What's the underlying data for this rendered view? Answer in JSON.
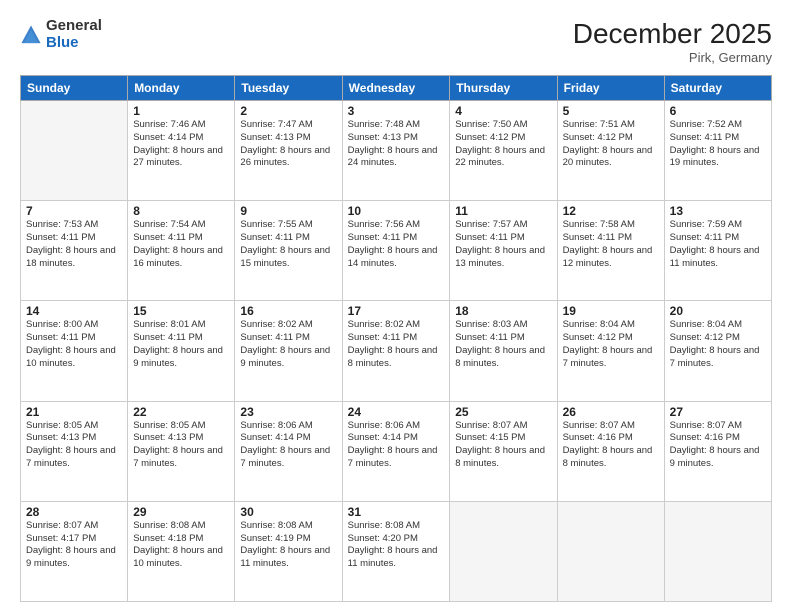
{
  "header": {
    "logo_general": "General",
    "logo_blue": "Blue",
    "month_title": "December 2025",
    "location": "Pirk, Germany"
  },
  "days_of_week": [
    "Sunday",
    "Monday",
    "Tuesday",
    "Wednesday",
    "Thursday",
    "Friday",
    "Saturday"
  ],
  "weeks": [
    [
      {
        "num": "",
        "sunrise": "",
        "sunset": "",
        "daylight": ""
      },
      {
        "num": "1",
        "sunrise": "Sunrise: 7:46 AM",
        "sunset": "Sunset: 4:14 PM",
        "daylight": "Daylight: 8 hours and 27 minutes."
      },
      {
        "num": "2",
        "sunrise": "Sunrise: 7:47 AM",
        "sunset": "Sunset: 4:13 PM",
        "daylight": "Daylight: 8 hours and 26 minutes."
      },
      {
        "num": "3",
        "sunrise": "Sunrise: 7:48 AM",
        "sunset": "Sunset: 4:13 PM",
        "daylight": "Daylight: 8 hours and 24 minutes."
      },
      {
        "num": "4",
        "sunrise": "Sunrise: 7:50 AM",
        "sunset": "Sunset: 4:12 PM",
        "daylight": "Daylight: 8 hours and 22 minutes."
      },
      {
        "num": "5",
        "sunrise": "Sunrise: 7:51 AM",
        "sunset": "Sunset: 4:12 PM",
        "daylight": "Daylight: 8 hours and 20 minutes."
      },
      {
        "num": "6",
        "sunrise": "Sunrise: 7:52 AM",
        "sunset": "Sunset: 4:11 PM",
        "daylight": "Daylight: 8 hours and 19 minutes."
      }
    ],
    [
      {
        "num": "7",
        "sunrise": "Sunrise: 7:53 AM",
        "sunset": "Sunset: 4:11 PM",
        "daylight": "Daylight: 8 hours and 18 minutes."
      },
      {
        "num": "8",
        "sunrise": "Sunrise: 7:54 AM",
        "sunset": "Sunset: 4:11 PM",
        "daylight": "Daylight: 8 hours and 16 minutes."
      },
      {
        "num": "9",
        "sunrise": "Sunrise: 7:55 AM",
        "sunset": "Sunset: 4:11 PM",
        "daylight": "Daylight: 8 hours and 15 minutes."
      },
      {
        "num": "10",
        "sunrise": "Sunrise: 7:56 AM",
        "sunset": "Sunset: 4:11 PM",
        "daylight": "Daylight: 8 hours and 14 minutes."
      },
      {
        "num": "11",
        "sunrise": "Sunrise: 7:57 AM",
        "sunset": "Sunset: 4:11 PM",
        "daylight": "Daylight: 8 hours and 13 minutes."
      },
      {
        "num": "12",
        "sunrise": "Sunrise: 7:58 AM",
        "sunset": "Sunset: 4:11 PM",
        "daylight": "Daylight: 8 hours and 12 minutes."
      },
      {
        "num": "13",
        "sunrise": "Sunrise: 7:59 AM",
        "sunset": "Sunset: 4:11 PM",
        "daylight": "Daylight: 8 hours and 11 minutes."
      }
    ],
    [
      {
        "num": "14",
        "sunrise": "Sunrise: 8:00 AM",
        "sunset": "Sunset: 4:11 PM",
        "daylight": "Daylight: 8 hours and 10 minutes."
      },
      {
        "num": "15",
        "sunrise": "Sunrise: 8:01 AM",
        "sunset": "Sunset: 4:11 PM",
        "daylight": "Daylight: 8 hours and 9 minutes."
      },
      {
        "num": "16",
        "sunrise": "Sunrise: 8:02 AM",
        "sunset": "Sunset: 4:11 PM",
        "daylight": "Daylight: 8 hours and 9 minutes."
      },
      {
        "num": "17",
        "sunrise": "Sunrise: 8:02 AM",
        "sunset": "Sunset: 4:11 PM",
        "daylight": "Daylight: 8 hours and 8 minutes."
      },
      {
        "num": "18",
        "sunrise": "Sunrise: 8:03 AM",
        "sunset": "Sunset: 4:11 PM",
        "daylight": "Daylight: 8 hours and 8 minutes."
      },
      {
        "num": "19",
        "sunrise": "Sunrise: 8:04 AM",
        "sunset": "Sunset: 4:12 PM",
        "daylight": "Daylight: 8 hours and 7 minutes."
      },
      {
        "num": "20",
        "sunrise": "Sunrise: 8:04 AM",
        "sunset": "Sunset: 4:12 PM",
        "daylight": "Daylight: 8 hours and 7 minutes."
      }
    ],
    [
      {
        "num": "21",
        "sunrise": "Sunrise: 8:05 AM",
        "sunset": "Sunset: 4:13 PM",
        "daylight": "Daylight: 8 hours and 7 minutes."
      },
      {
        "num": "22",
        "sunrise": "Sunrise: 8:05 AM",
        "sunset": "Sunset: 4:13 PM",
        "daylight": "Daylight: 8 hours and 7 minutes."
      },
      {
        "num": "23",
        "sunrise": "Sunrise: 8:06 AM",
        "sunset": "Sunset: 4:14 PM",
        "daylight": "Daylight: 8 hours and 7 minutes."
      },
      {
        "num": "24",
        "sunrise": "Sunrise: 8:06 AM",
        "sunset": "Sunset: 4:14 PM",
        "daylight": "Daylight: 8 hours and 7 minutes."
      },
      {
        "num": "25",
        "sunrise": "Sunrise: 8:07 AM",
        "sunset": "Sunset: 4:15 PM",
        "daylight": "Daylight: 8 hours and 8 minutes."
      },
      {
        "num": "26",
        "sunrise": "Sunrise: 8:07 AM",
        "sunset": "Sunset: 4:16 PM",
        "daylight": "Daylight: 8 hours and 8 minutes."
      },
      {
        "num": "27",
        "sunrise": "Sunrise: 8:07 AM",
        "sunset": "Sunset: 4:16 PM",
        "daylight": "Daylight: 8 hours and 9 minutes."
      }
    ],
    [
      {
        "num": "28",
        "sunrise": "Sunrise: 8:07 AM",
        "sunset": "Sunset: 4:17 PM",
        "daylight": "Daylight: 8 hours and 9 minutes."
      },
      {
        "num": "29",
        "sunrise": "Sunrise: 8:08 AM",
        "sunset": "Sunset: 4:18 PM",
        "daylight": "Daylight: 8 hours and 10 minutes."
      },
      {
        "num": "30",
        "sunrise": "Sunrise: 8:08 AM",
        "sunset": "Sunset: 4:19 PM",
        "daylight": "Daylight: 8 hours and 11 minutes."
      },
      {
        "num": "31",
        "sunrise": "Sunrise: 8:08 AM",
        "sunset": "Sunset: 4:20 PM",
        "daylight": "Daylight: 8 hours and 11 minutes."
      },
      {
        "num": "",
        "sunrise": "",
        "sunset": "",
        "daylight": ""
      },
      {
        "num": "",
        "sunrise": "",
        "sunset": "",
        "daylight": ""
      },
      {
        "num": "",
        "sunrise": "",
        "sunset": "",
        "daylight": ""
      }
    ]
  ]
}
